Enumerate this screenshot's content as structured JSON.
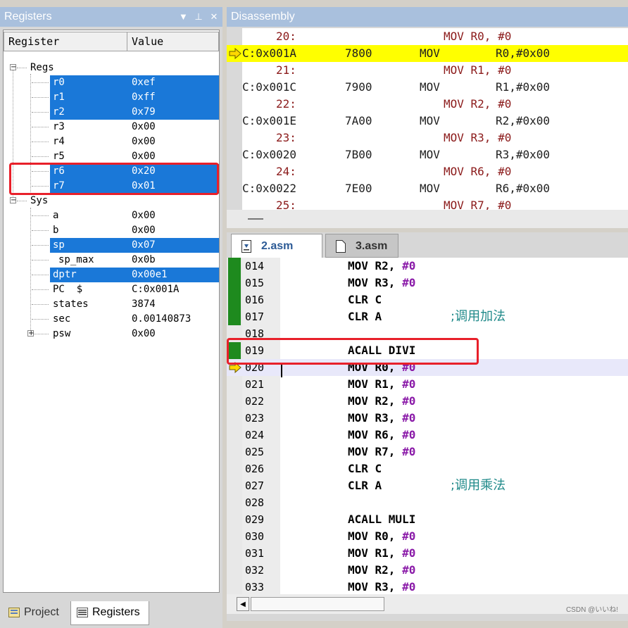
{
  "registers_panel": {
    "title": "Registers",
    "columns": [
      "Register",
      "Value"
    ],
    "groups": {
      "regs_label": "Regs",
      "sys_label": "Sys"
    },
    "rows": [
      {
        "name": "r0",
        "value": "0xef"
      },
      {
        "name": "r1",
        "value": "0xff"
      },
      {
        "name": "r2",
        "value": "0x79"
      },
      {
        "name": "r3",
        "value": "0x00"
      },
      {
        "name": "r4",
        "value": "0x00"
      },
      {
        "name": "r5",
        "value": "0x00"
      },
      {
        "name": "r6",
        "value": "0x20"
      },
      {
        "name": "r7",
        "value": "0x01"
      },
      {
        "name": "a",
        "value": "0x00"
      },
      {
        "name": "b",
        "value": "0x00"
      },
      {
        "name": "sp",
        "value": "0x07"
      },
      {
        "name": "sp_max",
        "value": "0x0b"
      },
      {
        "name": "dptr",
        "value": "0x00e1"
      },
      {
        "name": "PC  $",
        "value": "C:0x001A"
      },
      {
        "name": "states",
        "value": "3874"
      },
      {
        "name": "sec",
        "value": "0.00140873"
      },
      {
        "name": "psw",
        "value": "0x00"
      }
    ],
    "selection_color": "#1a78d8"
  },
  "bottom_tabs": {
    "project": "Project",
    "registers": "Registers"
  },
  "disassembly": {
    "title": "Disassembly",
    "lines": [
      {
        "type": "src",
        "num": "20:",
        "code": "MOV R0, #0"
      },
      {
        "type": "asm",
        "addr": "C:0x001A",
        "hex": "7800",
        "mnemonic": "MOV",
        "operands": "R0,#0x00"
      },
      {
        "type": "src",
        "num": "21:",
        "code": "MOV R1, #0"
      },
      {
        "type": "asm",
        "addr": "C:0x001C",
        "hex": "7900",
        "mnemonic": "MOV",
        "operands": "R1,#0x00"
      },
      {
        "type": "src",
        "num": "22:",
        "code": "MOV R2, #0"
      },
      {
        "type": "asm",
        "addr": "C:0x001E",
        "hex": "7A00",
        "mnemonic": "MOV",
        "operands": "R2,#0x00"
      },
      {
        "type": "src",
        "num": "23:",
        "code": "MOV R3, #0"
      },
      {
        "type": "asm",
        "addr": "C:0x0020",
        "hex": "7B00",
        "mnemonic": "MOV",
        "operands": "R3,#0x00"
      },
      {
        "type": "src",
        "num": "24:",
        "code": "MOV R6, #0"
      },
      {
        "type": "asm",
        "addr": "C:0x0022",
        "hex": "7E00",
        "mnemonic": "MOV",
        "operands": "R6,#0x00"
      },
      {
        "type": "src",
        "num": "25:",
        "code": "MOV R7, #0"
      }
    ],
    "current_color": "#ffff00"
  },
  "editor": {
    "tabs": [
      "2.asm",
      "3.asm"
    ],
    "lines": [
      {
        "num": "014",
        "code": "MOV R2, #0"
      },
      {
        "num": "015",
        "code": "MOV R3, #0"
      },
      {
        "num": "016",
        "code": "CLR C"
      },
      {
        "num": "017",
        "code": "CLR A",
        "comment": ";调用加法"
      },
      {
        "num": "018",
        "code": ""
      },
      {
        "num": "019",
        "code": "ACALL DIVI"
      },
      {
        "num": "020",
        "code": "MOV R0, #0"
      },
      {
        "num": "021",
        "code": "MOV R1, #0"
      },
      {
        "num": "022",
        "code": "MOV R2, #0"
      },
      {
        "num": "023",
        "code": "MOV R3, #0"
      },
      {
        "num": "024",
        "code": "MOV R6, #0"
      },
      {
        "num": "025",
        "code": "MOV R7, #0"
      },
      {
        "num": "026",
        "code": "CLR C"
      },
      {
        "num": "027",
        "code": "CLR A",
        "comment": ";调用乘法"
      },
      {
        "num": "028",
        "code": ""
      },
      {
        "num": "029",
        "code": "ACALL MULI"
      },
      {
        "num": "030",
        "code": "MOV R0, #0"
      },
      {
        "num": "031",
        "code": "MOV R1, #0"
      },
      {
        "num": "032",
        "code": "MOV R2, #0"
      },
      {
        "num": "033",
        "code": "MOV R3, #0"
      }
    ],
    "watermark": "CSDN @いいね!"
  },
  "colors": {
    "title_bar": "#a9c0dd",
    "highlight_box": "#e8202a",
    "executed_marker": "#1e8a1e"
  }
}
